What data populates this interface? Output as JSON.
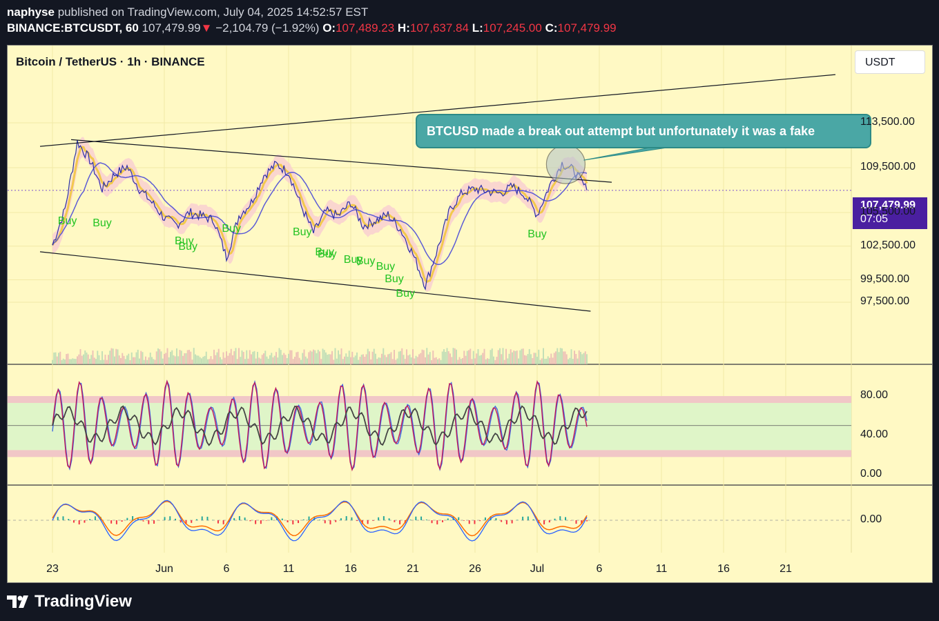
{
  "header": {
    "publisher": "naphyse",
    "published_text": "published on TradingView.com, July 04, 2025 14:52:57 EST",
    "symbol_interval": "BINANCE:BTCUSDT, 60",
    "last_price": "107,479.99",
    "change": "−2,104.79 (−1.92%)",
    "open_label": "O:",
    "open": "107,489.23",
    "high_label": "H:",
    "high": "107,637.84",
    "low_label": "L:",
    "low": "107,245.00",
    "close_label": "C:",
    "close": "107,479.99"
  },
  "chart": {
    "symbol_title": "Bitcoin / TetherUS · 1h · BINANCE",
    "currency": "USDT",
    "annotation": "BTCUSD made a break out attempt but unfortunately it was a fake",
    "price_tag": {
      "price": "107,479.99",
      "countdown": "07:05"
    },
    "buy_label": "Buy"
  },
  "chart_data": {
    "type": "line",
    "price_axis_ticks": [
      "113,500.00",
      "109,500.00",
      "105,500.00",
      "102,500.00",
      "99,500.00",
      "97,500.00"
    ],
    "price_axis_values": [
      113500,
      109500,
      105500,
      102500,
      99500,
      97500
    ],
    "oscillator_ticks": [
      "80.00",
      "40.00",
      "0.00"
    ],
    "oscillator_values": [
      80,
      40,
      0
    ],
    "macd_ticks": [
      "0.00"
    ],
    "macd_values": [
      0
    ],
    "x_ticks": [
      "23",
      "Jun",
      "6",
      "11",
      "16",
      "21",
      "26",
      "Jul",
      "6",
      "11",
      "16",
      "21"
    ],
    "x_tick_days": [
      0,
      9,
      14,
      19,
      24,
      29,
      34,
      39,
      44,
      49,
      54,
      59
    ],
    "price_path": [
      {
        "day": 0,
        "price": 102600
      },
      {
        "day": 1,
        "price": 105800
      },
      {
        "day": 2,
        "price": 111800
      },
      {
        "day": 3,
        "price": 110200
      },
      {
        "day": 4,
        "price": 107600
      },
      {
        "day": 5,
        "price": 108900
      },
      {
        "day": 6,
        "price": 109600
      },
      {
        "day": 7,
        "price": 107600
      },
      {
        "day": 8,
        "price": 106400
      },
      {
        "day": 9,
        "price": 105000
      },
      {
        "day": 10,
        "price": 104400
      },
      {
        "day": 11,
        "price": 105500
      },
      {
        "day": 12,
        "price": 105200
      },
      {
        "day": 13,
        "price": 104800
      },
      {
        "day": 14,
        "price": 101500
      },
      {
        "day": 15,
        "price": 105200
      },
      {
        "day": 16,
        "price": 106400
      },
      {
        "day": 17,
        "price": 108800
      },
      {
        "day": 18,
        "price": 109800
      },
      {
        "day": 19,
        "price": 109100
      },
      {
        "day": 20,
        "price": 106100
      },
      {
        "day": 21,
        "price": 103700
      },
      {
        "day": 22,
        "price": 105600
      },
      {
        "day": 23,
        "price": 105200
      },
      {
        "day": 24,
        "price": 106400
      },
      {
        "day": 25,
        "price": 104300
      },
      {
        "day": 26,
        "price": 104800
      },
      {
        "day": 27,
        "price": 105300
      },
      {
        "day": 28,
        "price": 104000
      },
      {
        "day": 29,
        "price": 101800
      },
      {
        "day": 30,
        "price": 99000
      },
      {
        "day": 31,
        "price": 102300
      },
      {
        "day": 32,
        "price": 105800
      },
      {
        "day": 33,
        "price": 107300
      },
      {
        "day": 34,
        "price": 107600
      },
      {
        "day": 35,
        "price": 107400
      },
      {
        "day": 36,
        "price": 107200
      },
      {
        "day": 37,
        "price": 107800
      },
      {
        "day": 38,
        "price": 107100
      },
      {
        "day": 39,
        "price": 105300
      },
      {
        "day": 40,
        "price": 107900
      },
      {
        "day": 41,
        "price": 109900
      },
      {
        "day": 42,
        "price": 109200
      },
      {
        "day": 43,
        "price": 107480
      }
    ],
    "last_price": 107479.99,
    "buy_signals": [
      {
        "day": 1.2,
        "price": 105900
      },
      {
        "day": 4.0,
        "price": 105700
      },
      {
        "day": 10.6,
        "price": 104100
      },
      {
        "day": 10.9,
        "price": 103600
      },
      {
        "day": 14.4,
        "price": 105200
      },
      {
        "day": 20.1,
        "price": 104900
      },
      {
        "day": 21.9,
        "price": 103100
      },
      {
        "day": 22.1,
        "price": 102900
      },
      {
        "day": 24.2,
        "price": 102400
      },
      {
        "day": 25.2,
        "price": 102300
      },
      {
        "day": 26.8,
        "price": 101800
      },
      {
        "day": 27.5,
        "price": 100700
      },
      {
        "day": 28.4,
        "price": 99400
      },
      {
        "day": 39.0,
        "price": 104700
      }
    ],
    "upper_trendline": [
      {
        "day": -1,
        "price": 111400
      },
      {
        "day": 63,
        "price": 117800
      }
    ],
    "channel_top": [
      {
        "day": 1.5,
        "price": 112000
      },
      {
        "day": 45,
        "price": 108200
      }
    ],
    "channel_bottom": [
      {
        "day": -1,
        "price": 102000
      },
      {
        "day": 43.3,
        "price": 96700
      }
    ],
    "highlight_zone": {
      "day": 41.3,
      "price": 109800
    }
  },
  "branding": {
    "name": "TradingView"
  },
  "colors": {
    "background": "#fff9c4",
    "page": "#131722",
    "price_line": "#2a2ea8",
    "callout": "#4aa7a5",
    "buy": "#22c322",
    "price_tag": "#4a1fa0",
    "down": "#f23645"
  }
}
